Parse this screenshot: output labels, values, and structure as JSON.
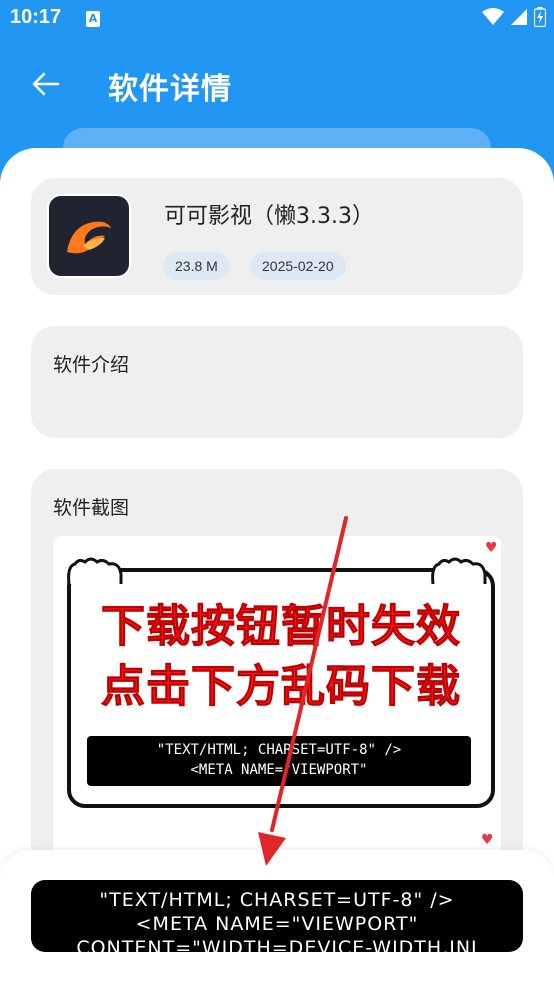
{
  "status_bar": {
    "time": "10:17",
    "app_icon_glyph": "A"
  },
  "app_bar": {
    "title": "软件详情"
  },
  "app_info": {
    "name": "可可影视（懒3.3.3）",
    "size": "23.8 M",
    "date": "2025-02-20"
  },
  "intro": {
    "label": "软件介绍"
  },
  "screenshots": {
    "label": "软件截图",
    "image_text": {
      "line1": "下载按钮暂时失效",
      "line2": "点击下方乱码下载",
      "code_line1": "\"TEXT/HTML; CHARSET=UTF-8\" />",
      "code_line2": "<META NAME=\"VIEWPORT\""
    }
  },
  "download_button": {
    "line1": "\"TEXT/HTML; CHARSET=UTF-8\" />",
    "line2": "<META NAME=\"VIEWPORT\"",
    "line3": "CONTENT=\"WIDTH=DEVICE-WIDTH,INI"
  },
  "icons": {
    "back": "arrow-left-icon",
    "wifi": "wifi-icon",
    "signal": "signal-icon",
    "battery": "battery-icon"
  },
  "colors": {
    "primary": "#2196f3",
    "card_bg": "#efefef",
    "tag_bg": "#dce9f5",
    "sign_red": "#ff1e1e",
    "arrow_red": "#e0262b"
  }
}
